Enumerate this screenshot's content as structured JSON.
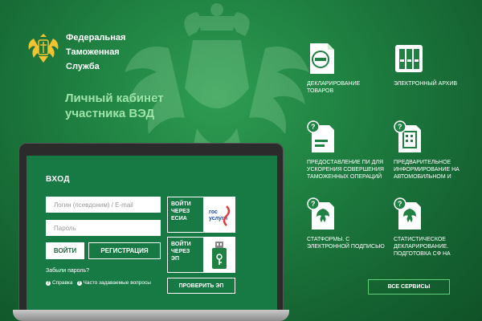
{
  "brand": {
    "name_lines": [
      "Федеральная",
      "Таможенная",
      "Служба"
    ]
  },
  "cabinet": {
    "lines": [
      "Личный кабинет",
      "участника ВЭД"
    ]
  },
  "login": {
    "title": "ВХОД",
    "login_placeholder": "Логин (псевдоним) / E-mail",
    "password_placeholder": "Пароль",
    "login_button": "ВОЙТИ",
    "register_button": "РЕГИСТРАЦИЯ",
    "forgot": "Забыли пароль?",
    "help": "Справка",
    "faq": "Часто задаваемые вопросы",
    "esia": {
      "lines": [
        "ВОЙТИ",
        "ЧЕРЕЗ",
        "ЕСИА"
      ],
      "logo_text": [
        "гос",
        "услуги"
      ]
    },
    "ep": {
      "lines": [
        "ВОЙТИ",
        "ЧЕРЕЗ",
        "ЭП"
      ]
    },
    "verify_button": "ПРОВЕРИТЬ ЭП"
  },
  "services": [
    {
      "icon": "declaration-icon",
      "lines": [
        "ДЕКЛАРИРОВАНИЕ",
        "ТОВАРОВ"
      ]
    },
    {
      "icon": "archive-icon",
      "lines": [
        "ЭЛЕКТРОННЫЙ АРХИВ"
      ]
    },
    {
      "icon": "document-question-icon",
      "lines": [
        "ПРЕДОСТАВЛЕНИЕ ПИ ДЛЯ",
        "УСКОРЕНИЯ СОВЕРШЕНИЯ",
        "ТАМОЖЕННЫХ ОПЕРАЦИЙ"
      ]
    },
    {
      "icon": "calculator-question-icon",
      "lines": [
        "ПРЕДВАРИТЕЛЬНОЕ",
        "ИНФОРМИРОВАНИЕ НА",
        "АВТОМОБИЛЬНОМ И"
      ]
    },
    {
      "icon": "emblem-question-icon",
      "lines": [
        "СТАТФОРМЫ. С",
        "ЭЛЕКТРОННОЙ ПОДПИСЬЮ"
      ]
    },
    {
      "icon": "emblem-question-icon",
      "lines": [
        "СТАТИСТИЧЕСКОЕ",
        "ДЕКЛАРИРОВАНИЕ.",
        "ПОДГОТОВКА СФ НА"
      ]
    }
  ],
  "all_services_button": "ВСЕ СЕРВИСЫ",
  "colors": {
    "background": "#1f8142",
    "screen": "#177a45",
    "accent_text": "#9fe3a8"
  }
}
